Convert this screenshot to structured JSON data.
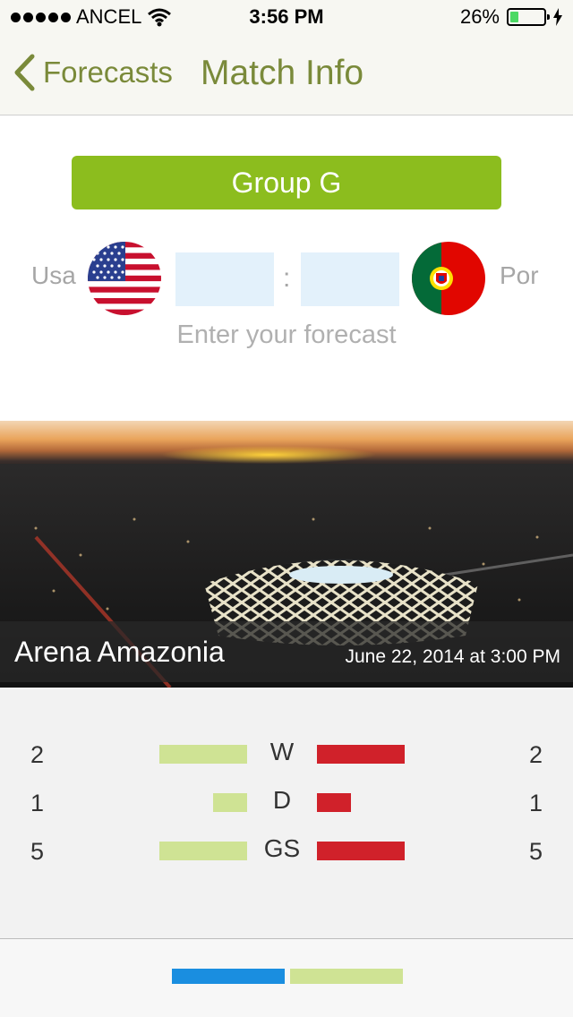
{
  "status_bar": {
    "carrier": "ANCEL",
    "time": "3:56 PM",
    "battery": "26%",
    "battery_level": 0.26,
    "signal_icon": "signal-dots-icon",
    "wifi_icon": "wifi-icon",
    "charging_icon": "bolt-icon"
  },
  "nav": {
    "back_label": "Forecasts",
    "back_icon": "chevron-left-icon",
    "title": "Match Info"
  },
  "match": {
    "group": "Group G",
    "home_team": "Usa",
    "away_team": "Por",
    "home_flag": "usa-flag",
    "away_flag": "portugal-flag",
    "home_score": "",
    "away_score": "",
    "separator": ":",
    "hint": "Enter your forecast"
  },
  "venue": {
    "name": "Arena Amazonia",
    "datetime": "June 22, 2014 at 3:00 PM"
  },
  "stats": [
    {
      "label": "W",
      "home": "2",
      "away": "2"
    },
    {
      "label": "D",
      "home": "1",
      "away": "1"
    },
    {
      "label": "GS",
      "home": "5",
      "away": "5"
    }
  ],
  "colors": {
    "accent": "#8cbd1e",
    "nav_text": "#7a8a3a",
    "home_bar": "#cfe394",
    "away_bar": "#d0212a",
    "input_bg": "#e3f1fb",
    "page_active": "#1a8ee0"
  },
  "pager": {
    "pages": 2,
    "active": 1
  }
}
